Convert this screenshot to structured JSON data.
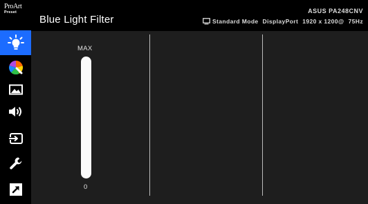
{
  "logo": {
    "line1": "ProArt",
    "line2": "Preset"
  },
  "sidebar": {
    "items": [
      {
        "icon": "bulb-icon",
        "active": true
      },
      {
        "icon": "color-icon",
        "active": false
      },
      {
        "icon": "image-icon",
        "active": false
      },
      {
        "icon": "sound-icon",
        "active": false
      },
      {
        "icon": "input-select-icon",
        "active": false
      },
      {
        "icon": "system-setup-icon",
        "active": false
      },
      {
        "icon": "shortcut-icon",
        "active": false
      }
    ]
  },
  "header": {
    "title": "Blue Light Filter",
    "model": "ASUS PA248CNV",
    "mode": "Standard Mode",
    "input": "DisplayPort",
    "resolution": "1920 x 1200@",
    "refresh": "75Hz"
  },
  "slider": {
    "max_label": "MAX",
    "min_label": "0",
    "value_fraction": 0
  },
  "colors": {
    "accent": "#1c6cff",
    "panel": "#1e1e1e",
    "background": "#000000"
  }
}
